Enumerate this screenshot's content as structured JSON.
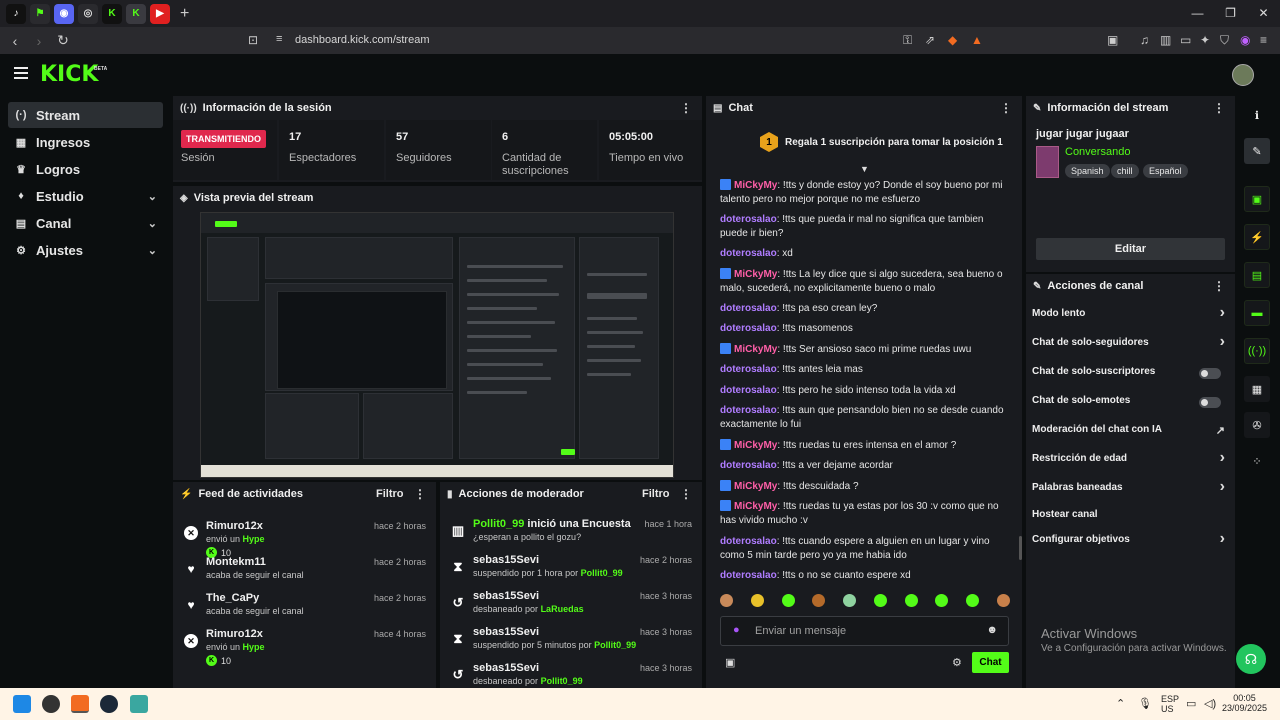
{
  "browser": {
    "url": "dashboard.kick.com/stream",
    "tabs": [
      {
        "name": "tiktok",
        "label": "♪",
        "color": "#ffffff",
        "bg": "#111111"
      },
      {
        "name": "robinhood",
        "label": "⚑",
        "color": "#53fc18",
        "bg": "#2a2a2e"
      },
      {
        "name": "discord",
        "label": "◉",
        "color": "#ffffff",
        "bg": "#5865f2"
      },
      {
        "name": "web",
        "label": "◎",
        "color": "#dddddd",
        "bg": "#2a2a2e"
      },
      {
        "name": "kick-1",
        "label": "K",
        "color": "#53fc18",
        "bg": "#111111"
      },
      {
        "name": "kick-2",
        "label": "K",
        "color": "#53fc18",
        "bg": "#111111"
      },
      {
        "name": "youtube",
        "label": "▶",
        "color": "#ffffff",
        "bg": "#e02020"
      }
    ]
  },
  "app": {
    "logo": "KICK",
    "beta": "BETA"
  },
  "sidebar": {
    "items": [
      {
        "label": "Stream",
        "icon": "(·)",
        "active": true,
        "chevron": false
      },
      {
        "label": "Ingresos",
        "icon": "▦",
        "active": false,
        "chevron": false
      },
      {
        "label": "Logros",
        "icon": "♛",
        "active": false,
        "chevron": false
      },
      {
        "label": "Estudio",
        "icon": "♦",
        "active": false,
        "chevron": true
      },
      {
        "label": "Canal",
        "icon": "▤",
        "active": false,
        "chevron": true
      },
      {
        "label": "Ajustes",
        "icon": "⚙",
        "active": false,
        "chevron": true
      }
    ]
  },
  "session": {
    "title": "Información de la sesión",
    "badge": "TRANSMITIENDO",
    "badge_label": "Sesión",
    "stats": [
      {
        "value": "17",
        "label": "Espectadores"
      },
      {
        "value": "57",
        "label": "Seguidores"
      },
      {
        "value": "6",
        "label": "Cantidad de suscripciones"
      },
      {
        "value": "05:05:00",
        "label": "Tiempo en vivo"
      }
    ]
  },
  "preview": {
    "title": "Vista previa del stream"
  },
  "feed": {
    "title": "Feed de actividades",
    "filter": "Filtro",
    "items": [
      {
        "name": "Rimuro12x",
        "time": "hace 2 horas",
        "pre": "envió un ",
        "hl": "Hype",
        "extra": "10",
        "icon": "x"
      },
      {
        "name": "Montekm11",
        "time": "hace 2 horas",
        "pre": "acaba de seguir el canal",
        "hl": "",
        "extra": "",
        "icon": "heart"
      },
      {
        "name": "The_CaPy",
        "time": "hace 2 horas",
        "pre": "acaba de seguir el canal",
        "hl": "",
        "extra": "",
        "icon": "heart"
      },
      {
        "name": "Rimuro12x",
        "time": "hace 4 horas",
        "pre": "envió un ",
        "hl": "Hype",
        "extra": "10",
        "icon": "x"
      }
    ]
  },
  "mod": {
    "title": "Acciones de moderador",
    "filter": "Filtro",
    "items": [
      {
        "name": "Pollit0_99",
        "name_green": true,
        "action": " inició una Encuesta",
        "time": "hace 1 hora",
        "sub_pre": "¿esperan a pollito el gozu?",
        "sub_hl": "",
        "icon": "poll"
      },
      {
        "name": "sebas15Sevi",
        "name_green": false,
        "action": "",
        "time": "hace 2 horas",
        "sub_pre": "suspendido por 1 hora por ",
        "sub_hl": "Pollit0_99",
        "icon": "timer"
      },
      {
        "name": "sebas15Sevi",
        "name_green": false,
        "action": "",
        "time": "hace 3 horas",
        "sub_pre": "desbaneado por ",
        "sub_hl": "LaRuedas",
        "icon": "undo"
      },
      {
        "name": "sebas15Sevi",
        "name_green": false,
        "action": "",
        "time": "hace 3 horas",
        "sub_pre": "suspendido por 5 minutos por ",
        "sub_hl": "Pollit0_99",
        "icon": "timer"
      },
      {
        "name": "sebas15Sevi",
        "name_green": false,
        "action": "",
        "time": "hace 3 horas",
        "sub_pre": "desbaneado por ",
        "sub_hl": "Pollit0_99",
        "icon": "undo"
      }
    ]
  },
  "chat": {
    "title": "Chat",
    "pinned_rank": "1",
    "pinned_text": "Regala 1 suscripción para tomar la posición 1",
    "messages": [
      {
        "user": "MiCkyMy",
        "badge": true,
        "text": ": !tts y donde estoy yo? Donde el soy bueno por mi talento pero no mejor porque no me esfuerzo"
      },
      {
        "user": "doterosalao",
        "badge": false,
        "text": ": !tts que pueda ir mal no significa que tambien puede ir bien?"
      },
      {
        "user": "doterosalao",
        "badge": false,
        "text": ": xd"
      },
      {
        "user": "MiCkyMy",
        "badge": true,
        "text": ": !tts La ley dice que si algo sucedera, sea bueno o malo, sucederá, no explicitamente bueno o malo"
      },
      {
        "user": "doterosalao",
        "badge": false,
        "text": ": !tts pa eso crean ley?"
      },
      {
        "user": "doterosalao",
        "badge": false,
        "text": ": !tts masomenos"
      },
      {
        "user": "MiCkyMy",
        "badge": true,
        "text": ": !tts Ser ansioso saco mi prime ruedas uwu"
      },
      {
        "user": "doterosalao",
        "badge": false,
        "text": ": !tts antes leia mas"
      },
      {
        "user": "doterosalao",
        "badge": false,
        "text": ": !tts pero he sido intenso toda la vida xd"
      },
      {
        "user": "doterosalao",
        "badge": false,
        "text": ": !tts aun que pensandolo bien no se desde cuando exactamente lo fui"
      },
      {
        "user": "MiCkyMy",
        "badge": true,
        "text": ": !tts ruedas tu eres intensa en el amor ?"
      },
      {
        "user": "doterosalao",
        "badge": false,
        "text": ": !tts a ver dejame acordar"
      },
      {
        "user": "MiCkyMy",
        "badge": true,
        "text": ": !tts descuidada ?"
      },
      {
        "user": "MiCkyMy",
        "badge": true,
        "text": ": !tts ruedas tu ya estas por los 30 :v como que no has vivido mucho :v"
      },
      {
        "user": "doterosalao",
        "badge": false,
        "text": ": !tts cuando espere a alguien en un lugar y vino como 5 min tarde pero yo ya me habia ido"
      },
      {
        "user": "doterosalao",
        "badge": false,
        "text": ": !tts o no se cuanto espere xd"
      }
    ],
    "input_placeholder": "Enviar un mensaje",
    "send_label": "Chat"
  },
  "stream_info": {
    "title": "Información del stream",
    "stream_title": "jugar jugar jugaar",
    "category": "Conversando",
    "tags": [
      "Spanish",
      "chill",
      "Español"
    ],
    "edit_label": "Editar"
  },
  "channel_actions": {
    "title": "Acciones de canal",
    "items": [
      {
        "label": "Modo lento",
        "type": "arrow"
      },
      {
        "label": "Chat de solo-seguidores",
        "type": "arrow"
      },
      {
        "label": "Chat de solo-suscriptores",
        "type": "toggle"
      },
      {
        "label": "Chat de solo-emotes",
        "type": "toggle"
      },
      {
        "label": "Moderación del chat con IA",
        "type": "external"
      },
      {
        "label": "Restricción de edad",
        "type": "arrow"
      },
      {
        "label": "Palabras baneadas",
        "type": "arrow"
      },
      {
        "label": "Hostear canal",
        "type": "none"
      },
      {
        "label": "Configurar objetivos",
        "type": "arrow"
      }
    ]
  },
  "watermark": {
    "line1": "Activar Windows",
    "line2": "Ve a Configuración para activar Windows."
  },
  "taskbar": {
    "lang1": "ESP",
    "lang2": "US",
    "time": "00:05",
    "date": "23/09/2025"
  },
  "colors": {
    "kick_green": "#53fc18",
    "live_red": "#e0284d",
    "username_pink": "#ff5fa8",
    "username_purple": "#b07dff"
  }
}
